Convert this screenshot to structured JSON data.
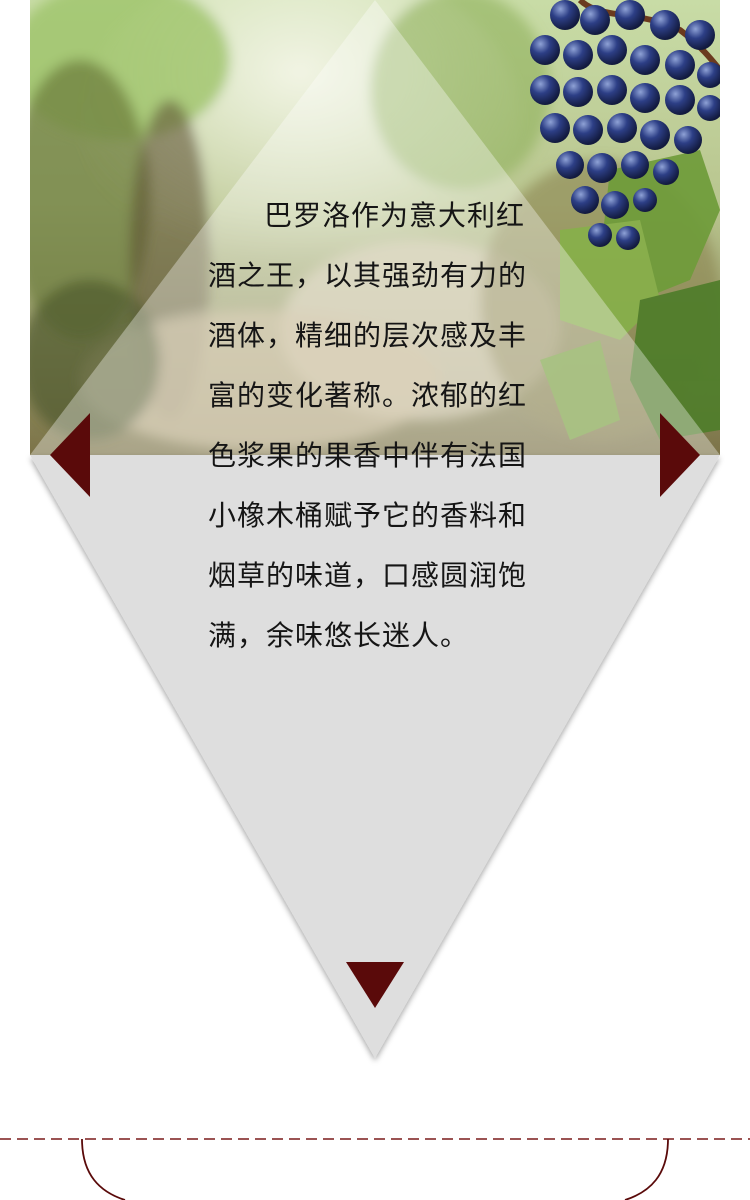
{
  "description_text": "巴罗洛作为意大利红酒之王，以其强劲有力的酒体，精细的层次感及丰富的变化著称。浓郁的红色浆果的果香中伴有法国小橡木桶赋予它的香料和烟草的味道，口感圆润饱满，余味悠长迷人。",
  "colors": {
    "accent": "#5a0a0a",
    "panel": "#dedede",
    "text": "#151515",
    "dashed_line": "#7a1a1a"
  },
  "icons": {
    "left": "arrow-left-icon",
    "right": "arrow-right-icon",
    "down": "arrow-down-icon"
  },
  "image": "vineyard-grapes-photo"
}
